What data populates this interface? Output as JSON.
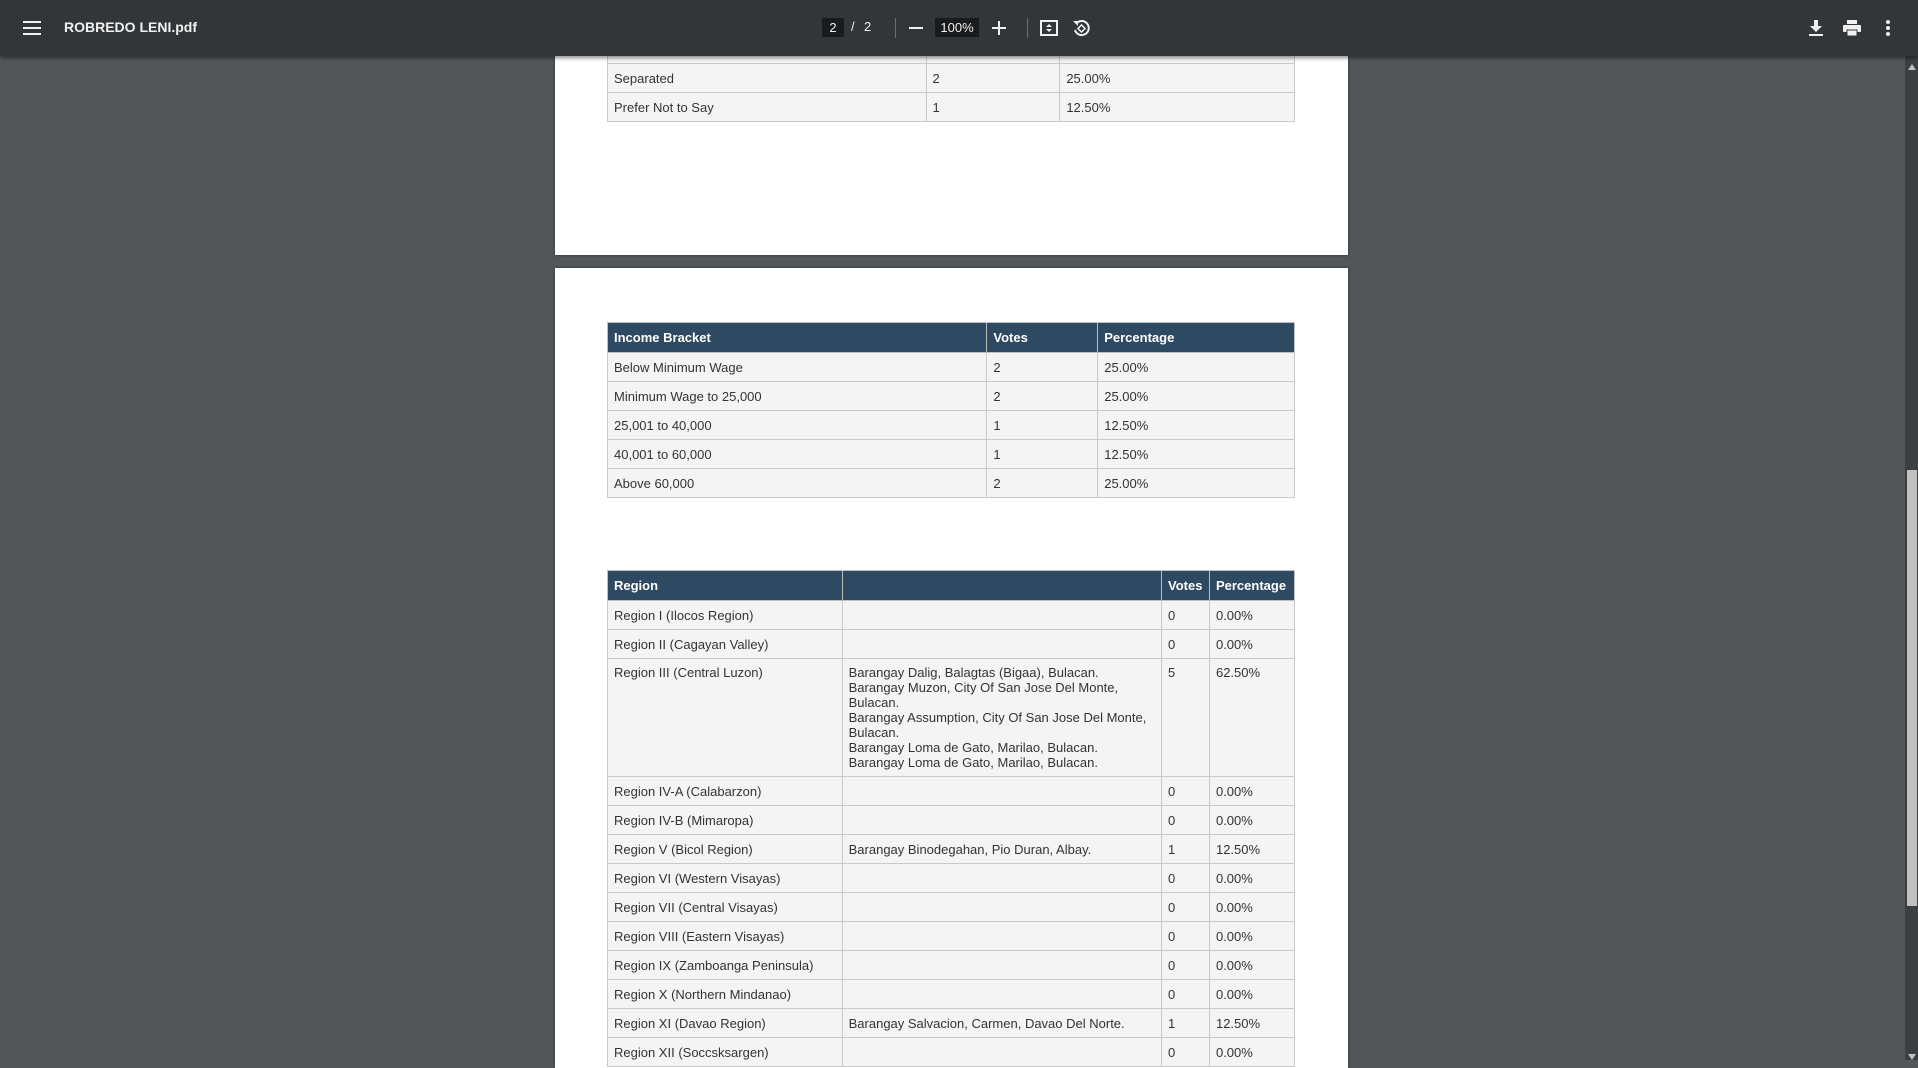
{
  "toolbar": {
    "title": "ROBREDO LENI.pdf",
    "current_page": "2",
    "page_separator": "/",
    "total_pages": "2",
    "zoom": "100%",
    "icons": [
      "menu-icon",
      "zoom-out-icon",
      "zoom-in-icon",
      "fit-page-icon",
      "rotate-icon",
      "download-icon",
      "print-icon",
      "more-options-icon"
    ]
  },
  "civil_status_table": {
    "rows": [
      {
        "label": "Separated",
        "votes": "2",
        "percentage": "25.00%"
      },
      {
        "label": "Prefer Not to Say",
        "votes": "1",
        "percentage": "12.50%"
      }
    ]
  },
  "income_table": {
    "headers": {
      "category": "Income Bracket",
      "votes": "Votes",
      "percentage": "Percentage"
    },
    "rows": [
      {
        "label": "Below Minimum Wage",
        "votes": "2",
        "percentage": "25.00%"
      },
      {
        "label": "Minimum Wage to 25,000",
        "votes": "2",
        "percentage": "25.00%"
      },
      {
        "label": "25,001 to 40,000",
        "votes": "1",
        "percentage": "12.50%"
      },
      {
        "label": "40,001 to 60,000",
        "votes": "1",
        "percentage": "12.50%"
      },
      {
        "label": "Above 60,000",
        "votes": "2",
        "percentage": "25.00%"
      }
    ]
  },
  "region_table": {
    "headers": {
      "category": "Region",
      "locations": "",
      "votes": "Votes",
      "percentage": "Percentage"
    },
    "rows": [
      {
        "label": "Region I (Ilocos Region)",
        "locations": [],
        "votes": "0",
        "percentage": "0.00%"
      },
      {
        "label": "Region II (Cagayan Valley)",
        "locations": [],
        "votes": "0",
        "percentage": "0.00%"
      },
      {
        "label": "Region III (Central Luzon)",
        "locations": [
          "Barangay Dalig, Balagtas (Bigaa), Bulacan.",
          "Barangay Muzon, City Of San Jose Del Monte, Bulacan.",
          "Barangay Assumption, City Of San Jose Del Monte, Bulacan.",
          "Barangay Loma de Gato, Marilao, Bulacan.",
          "Barangay Loma de Gato, Marilao, Bulacan."
        ],
        "votes": "5",
        "percentage": "62.50%"
      },
      {
        "label": "Region IV-A (Calabarzon)",
        "locations": [],
        "votes": "0",
        "percentage": "0.00%"
      },
      {
        "label": "Region IV-B (Mimaropa)",
        "locations": [],
        "votes": "0",
        "percentage": "0.00%"
      },
      {
        "label": "Region V (Bicol Region)",
        "locations": [
          "Barangay Binodegahan, Pio Duran, Albay."
        ],
        "votes": "1",
        "percentage": "12.50%"
      },
      {
        "label": "Region VI (Western Visayas)",
        "locations": [],
        "votes": "0",
        "percentage": "0.00%"
      },
      {
        "label": "Region VII (Central Visayas)",
        "locations": [],
        "votes": "0",
        "percentage": "0.00%"
      },
      {
        "label": "Region VIII (Eastern Visayas)",
        "locations": [],
        "votes": "0",
        "percentage": "0.00%"
      },
      {
        "label": "Region IX (Zamboanga Peninsula)",
        "locations": [],
        "votes": "0",
        "percentage": "0.00%"
      },
      {
        "label": "Region X (Northern Mindanao)",
        "locations": [],
        "votes": "0",
        "percentage": "0.00%"
      },
      {
        "label": "Region XI (Davao Region)",
        "locations": [
          "Barangay Salvacion, Carmen, Davao Del Norte."
        ],
        "votes": "1",
        "percentage": "12.50%"
      },
      {
        "label": "Region XII (Soccsksargen)",
        "locations": [],
        "votes": "0",
        "percentage": "0.00%"
      }
    ]
  },
  "colors": {
    "viewer_background": "#525659",
    "toolbar_background": "#323639",
    "table_header": "#2e4a62",
    "cell_background": "#f4f4f4"
  }
}
